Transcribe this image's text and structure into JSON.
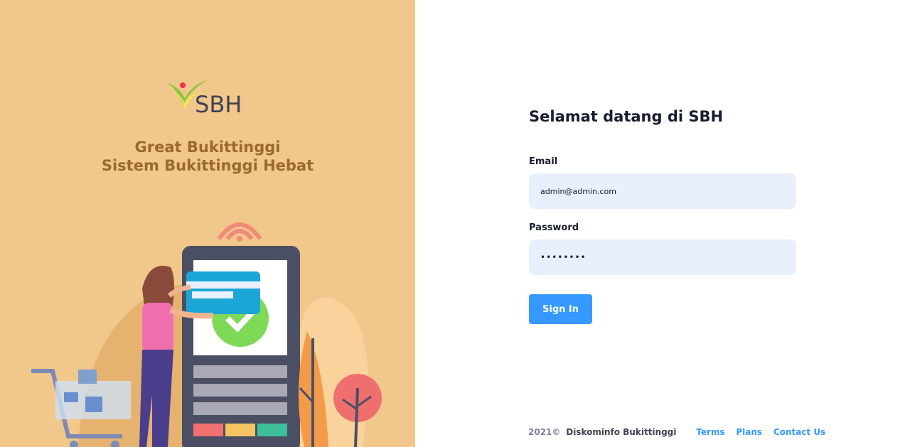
{
  "aside": {
    "logo_text": "SBH",
    "tagline_line1": "Great Bukittinggi",
    "tagline_line2": "Sistem Bukittinggi Hebat",
    "colors": {
      "background": "#f1c78b",
      "tagline": "#9a6a2a"
    }
  },
  "form": {
    "title": "Selamat datang di SBH",
    "email_label": "Email",
    "email_value": "admin@admin.com",
    "password_label": "Password",
    "password_value": "password",
    "submit_label": "Sign In"
  },
  "footer": {
    "copyright_year": "2021©",
    "organization": "Diskominfo Bukittinggi",
    "links": [
      "Terms",
      "Plans",
      "Contact Us"
    ]
  },
  "colors": {
    "primary": "#3699ff",
    "input_bg": "#e8f0fe",
    "heading": "#181c32"
  }
}
